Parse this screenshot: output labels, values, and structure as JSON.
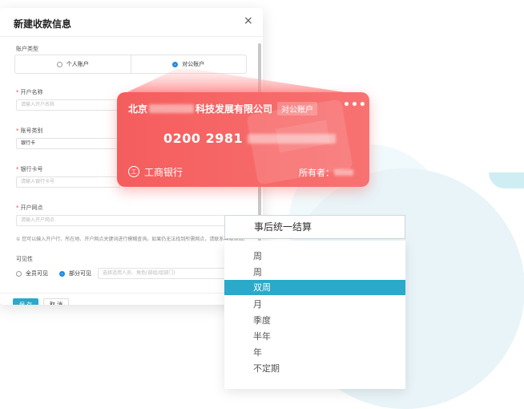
{
  "dialog": {
    "title": "新建收款信息",
    "close": "×",
    "account_type_label": "账户类型",
    "account_types": [
      "个人账户",
      "对公账户"
    ],
    "account_name_label": "开户名称",
    "account_name_placeholder": "请输入开户名称",
    "account_category_label": "账号类别",
    "account_category_value": "银行卡",
    "card_number_label": "银行卡号",
    "card_number_placeholder": "请输入银行卡号",
    "branch_label": "开户网点",
    "branch_placeholder": "请输入开户网点",
    "branch_hint": "① 您可以输入开户行、所在地、开户网点关键词进行模糊查询。如果仍无法找到所需网点，请联系客服添加。",
    "visibility_label": "可见性",
    "visibility_options": [
      "全员可见",
      "部分可见"
    ],
    "visibility_placeholder": "选择适用人员、角色(部组/组部门)",
    "save": "保 存",
    "cancel": "取 消"
  },
  "card": {
    "name_prefix": "北京",
    "name_suffix": "科技发展有限公司",
    "tag": "对公账户",
    "more": "•••",
    "number_prefix": "0200 2981",
    "bank_name": "工商银行",
    "owner_label": "所有者："
  },
  "dropdown": {
    "selected": "事后统一结算",
    "items": [
      "周",
      "周",
      "双周",
      "月",
      "季度",
      "半年",
      "年",
      "不定期"
    ],
    "highlighted_index": 2
  },
  "colors": {
    "accent": "#2aa9c9",
    "card": "#f55d5d",
    "required": "#ff4444"
  }
}
